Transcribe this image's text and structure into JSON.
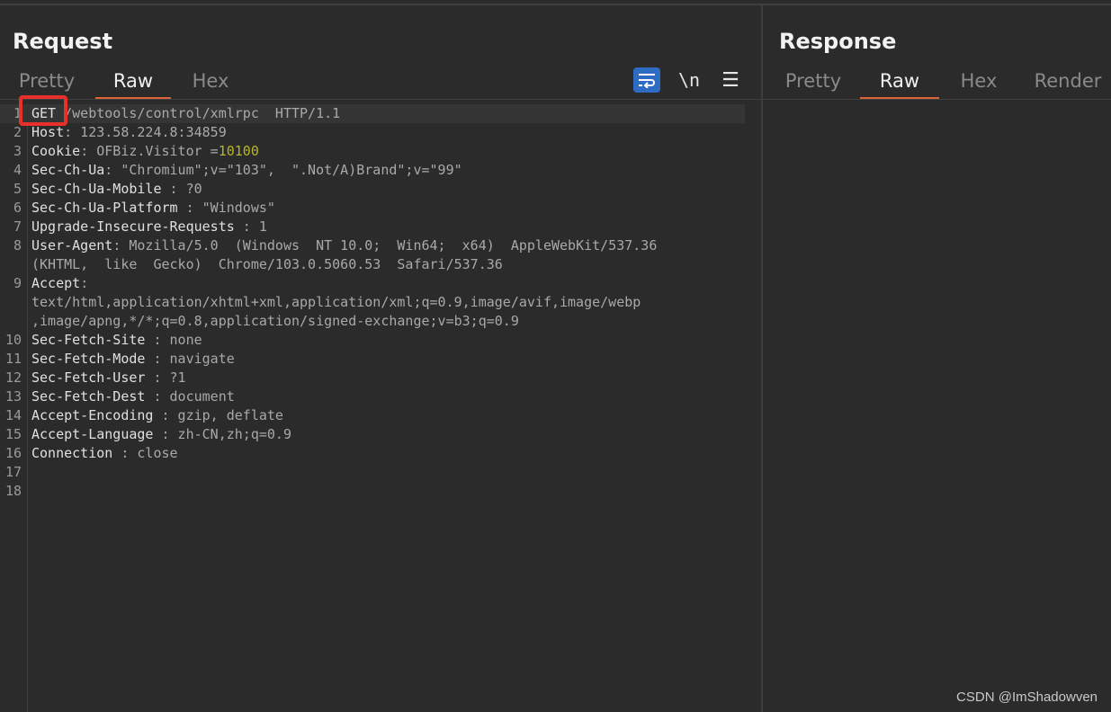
{
  "request": {
    "title": "Request",
    "tabs": [
      "Pretty",
      "Raw",
      "Hex"
    ],
    "active_tab": "Raw",
    "toolbar": {
      "wrap_icon": "word-wrap-icon",
      "newline_label": "\\n",
      "menu_icon": "hamburger-menu-icon"
    }
  },
  "response": {
    "title": "Response",
    "tabs": [
      "Pretty",
      "Raw",
      "Hex",
      "Render"
    ],
    "active_tab": "Raw"
  },
  "editor": {
    "lines": [
      {
        "n": "1",
        "key": "GET",
        "val": " /webtools/control/xmlrpc  HTTP/1.1",
        "hl": true
      },
      {
        "n": "2",
        "key": "Host",
        "val": ": 123.58.224.8:34859"
      },
      {
        "n": "3",
        "key": "Cookie",
        "val": ": OFBiz.Visitor =",
        "extra": "10100"
      },
      {
        "n": "4",
        "key": "Sec-Ch-Ua",
        "val": ": \"Chromium\";v=\"103\",  \".Not/A)Brand\";v=\"99\""
      },
      {
        "n": "5",
        "key": "Sec-Ch-Ua-Mobile",
        "val": " : ?0"
      },
      {
        "n": "6",
        "key": "Sec-Ch-Ua-Platform",
        "val": " : \"Windows\""
      },
      {
        "n": "7",
        "key": "Upgrade-Insecure-Requests",
        "val": " : 1"
      },
      {
        "n": "8",
        "key": "User-Agent",
        "val": ": Mozilla/5.0  (Windows  NT 10.0;  Win64;  x64)  AppleWebKit/537.36"
      },
      {
        "n": "",
        "key": "",
        "val": "(KHTML,  like  Gecko)  Chrome/103.0.5060.53  Safari/537.36"
      },
      {
        "n": "9",
        "key": "Accept",
        "val": ":"
      },
      {
        "n": "",
        "key": "",
        "val": "text/html,application/xhtml+xml,application/xml;q=0.9,image/avif,image/webp"
      },
      {
        "n": "",
        "key": "",
        "val": ",image/apng,*/*;q=0.8,application/signed-exchange;v=b3;q=0.9"
      },
      {
        "n": "10",
        "key": "Sec-Fetch-Site",
        "val": " : none"
      },
      {
        "n": "11",
        "key": "Sec-Fetch-Mode",
        "val": " : navigate"
      },
      {
        "n": "12",
        "key": "Sec-Fetch-User",
        "val": " : ?1"
      },
      {
        "n": "13",
        "key": "Sec-Fetch-Dest",
        "val": " : document"
      },
      {
        "n": "14",
        "key": "Accept-Encoding",
        "val": " : gzip, deflate"
      },
      {
        "n": "15",
        "key": "Accept-Language",
        "val": " : zh-CN,zh;q=0.9"
      },
      {
        "n": "16",
        "key": "Connection",
        "val": " : close"
      },
      {
        "n": "17",
        "key": "",
        "val": ""
      },
      {
        "n": "18",
        "key": "",
        "val": ""
      }
    ]
  },
  "watermark": "CSDN @ImShadowven",
  "colors": {
    "accent": "#e0643a",
    "wrap_button": "#2e6cc4",
    "highlight_box": "#e8302b",
    "cookie_value": "#b6b62a"
  }
}
